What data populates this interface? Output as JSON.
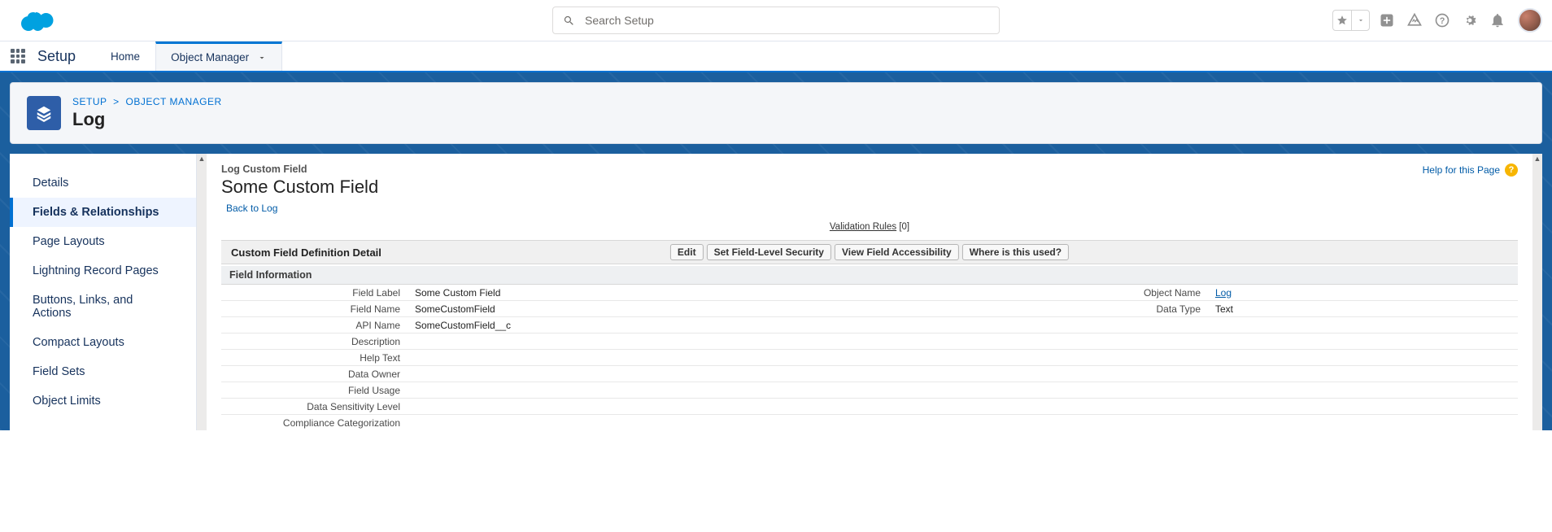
{
  "header": {
    "search_placeholder": "Search Setup"
  },
  "context": {
    "app_name": "Setup",
    "tabs": [
      {
        "label": "Home"
      },
      {
        "label": "Object Manager"
      }
    ]
  },
  "page_header": {
    "breadcrumb_setup": "SETUP",
    "breadcrumb_objmgr": "OBJECT MANAGER",
    "title": "Log"
  },
  "sidebar": {
    "items": [
      {
        "label": "Details"
      },
      {
        "label": "Fields & Relationships"
      },
      {
        "label": "Page Layouts"
      },
      {
        "label": "Lightning Record Pages"
      },
      {
        "label": "Buttons, Links, and Actions"
      },
      {
        "label": "Compact Layouts"
      },
      {
        "label": "Field Sets"
      },
      {
        "label": "Object Limits"
      }
    ]
  },
  "detail": {
    "supertitle": "Log Custom Field",
    "title": "Some Custom Field",
    "back_link": "Back to Log",
    "help_label": "Help for this Page",
    "validation_label": "Validation Rules",
    "validation_count": "[0]",
    "section_title": "Custom Field Definition Detail",
    "buttons": {
      "edit": "Edit",
      "fls": "Set Field-Level Security",
      "vfa": "View Field Accessibility",
      "where": "Where is this used?"
    },
    "subsection": "Field Information",
    "rows": {
      "field_label_l": "Field Label",
      "field_label_v": "Some Custom Field",
      "object_name_l": "Object Name",
      "object_name_v": "Log",
      "field_name_l": "Field Name",
      "field_name_v": "SomeCustomField",
      "data_type_l": "Data Type",
      "data_type_v": "Text",
      "api_name_l": "API Name",
      "api_name_v": "SomeCustomField__c",
      "description_l": "Description",
      "help_text_l": "Help Text",
      "data_owner_l": "Data Owner",
      "field_usage_l": "Field Usage",
      "sensitivity_l": "Data Sensitivity Level",
      "compliance_l": "Compliance Categorization"
    }
  }
}
